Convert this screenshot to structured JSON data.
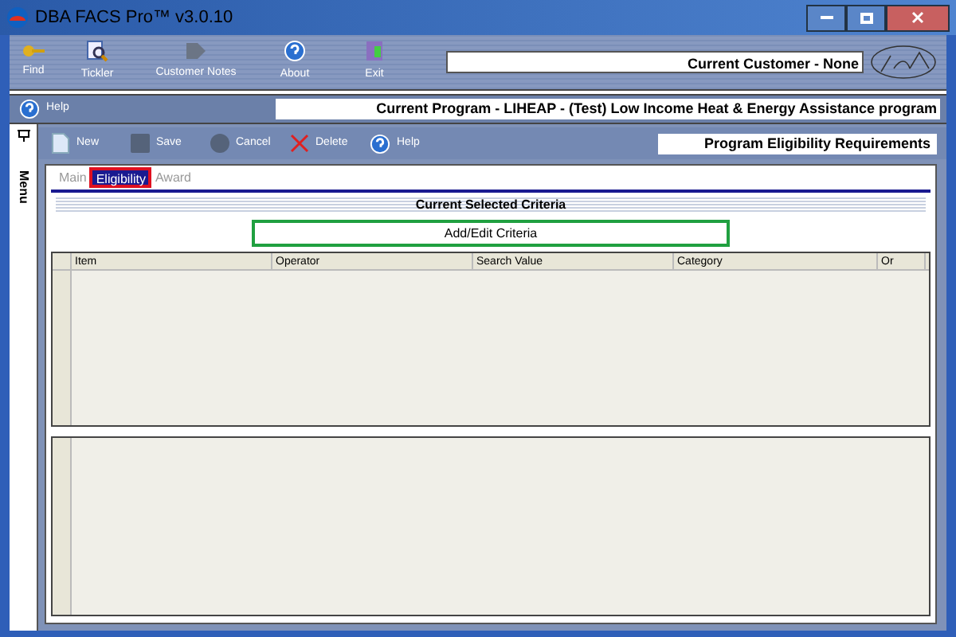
{
  "window": {
    "title": "DBA FACS Pro™ v3.0.10"
  },
  "toolbar": [
    {
      "label": "Find",
      "kind": "find"
    },
    {
      "label": "Tickler",
      "kind": "tickler"
    },
    {
      "label": "Customer Notes",
      "kind": "notes"
    },
    {
      "label": "About",
      "kind": "about"
    },
    {
      "label": "Exit",
      "kind": "exit"
    }
  ],
  "current_customer": "Current Customer - None",
  "help_bar": {
    "label": "Help",
    "current_program": "Current Program - LIHEAP - (Test) Low Income Heat & Energy Assistance program"
  },
  "side_menu": {
    "label": "Menu"
  },
  "actions": [
    {
      "label": "New",
      "kind": "new"
    },
    {
      "label": "Save",
      "kind": "save"
    },
    {
      "label": "Cancel",
      "kind": "cancel"
    },
    {
      "label": "Delete",
      "kind": "delete"
    },
    {
      "label": "Help",
      "kind": "help"
    }
  ],
  "section_title": "Program Eligibility Requirements",
  "tabs": [
    {
      "label": "Main",
      "selected": false
    },
    {
      "label": "Eligibility",
      "selected": true
    },
    {
      "label": "Award",
      "selected": false
    }
  ],
  "criteria_title": "Current Selected Criteria",
  "add_button": "Add/Edit Criteria",
  "table": {
    "columns": [
      "Item",
      "Operator",
      "Search Value",
      "Category",
      "Or"
    ]
  }
}
